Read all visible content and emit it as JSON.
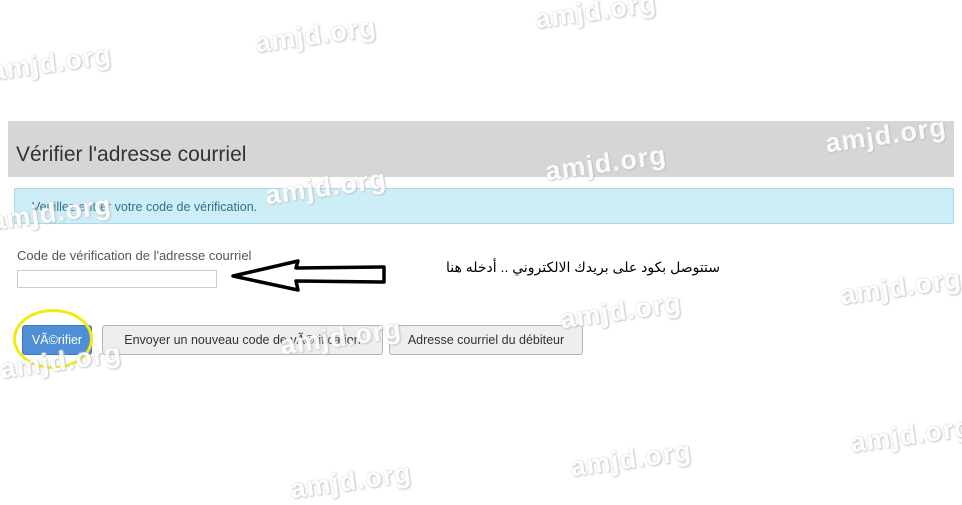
{
  "header": {
    "title": "Vérifier l'adresse courriel"
  },
  "alert": {
    "message": "Veuillez entrer votre code de vérification."
  },
  "form": {
    "code_label": "Code de vérification de l'adresse courriel",
    "code_value": ""
  },
  "buttons": {
    "verify_label": "VÃ©rifier",
    "resend_label": "Envoyer un nouveau code de vÃ©rification",
    "debtor_label": "Adresse courriel du débiteur"
  },
  "annotation": {
    "text": "ستتوصل بكود على بريدك الالكتروني .. أدخله هنا"
  },
  "watermark": {
    "text": "amjd.org"
  },
  "colors": {
    "header_bg": "#d6d6d6",
    "alert_bg": "#cdeef7",
    "primary": "#4e8fd6",
    "highlight": "#f2eb0c"
  }
}
